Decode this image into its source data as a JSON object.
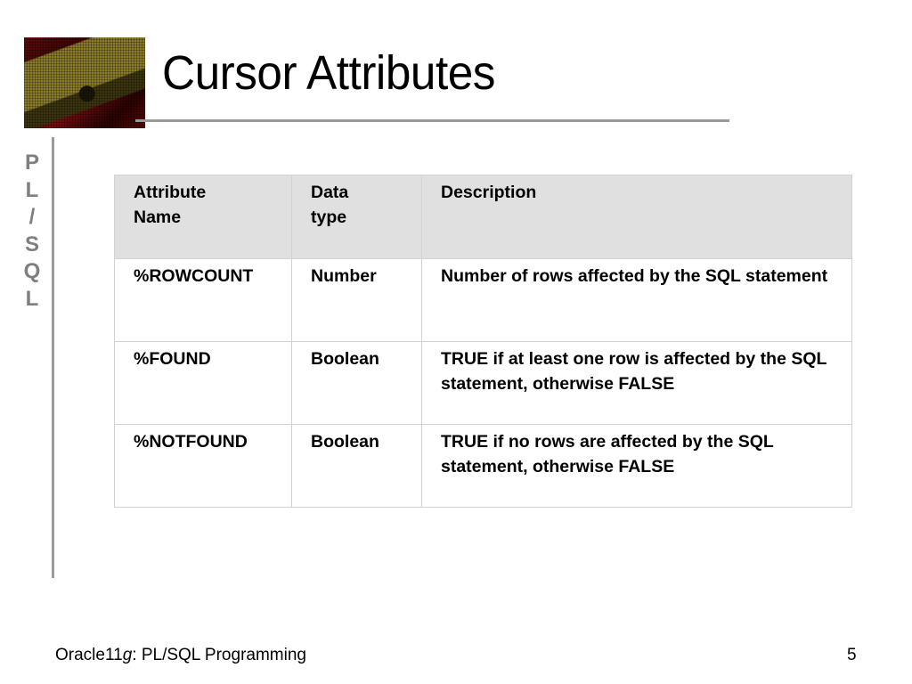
{
  "slide": {
    "title": "Cursor Attributes",
    "side_label_letters": [
      "P",
      "L",
      "/",
      "S",
      "Q",
      "L"
    ],
    "logo_icon": "book-image-icon"
  },
  "table": {
    "headers": {
      "name_line1": "Attribute",
      "name_line2": "Name",
      "type_line1": "Data",
      "type_line2": "type",
      "description": "Description"
    },
    "rows": [
      {
        "name": "%ROWCOUNT",
        "type": "Number",
        "description": "Number of rows affected by the SQL statement"
      },
      {
        "name": "%FOUND",
        "type": "Boolean",
        "description": "TRUE if at least one row is affected by the SQL statement, otherwise FALSE"
      },
      {
        "name": "%NOTFOUND",
        "type": "Boolean",
        "description": "TRUE if no rows are affected by the SQL statement, otherwise FALSE"
      }
    ]
  },
  "footer": {
    "course_prefix": "Oracle11",
    "course_italic": "g",
    "course_suffix": ": PL/SQL Programming",
    "page_number": "5"
  },
  "colors": {
    "header_background": "#e0e0e0",
    "side_label": "#7f7f7f",
    "rule": "#999999"
  }
}
